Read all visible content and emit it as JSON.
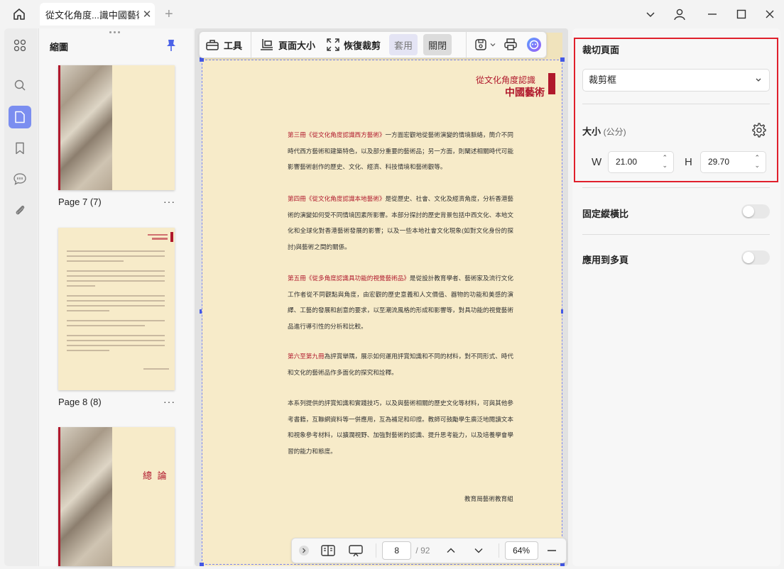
{
  "tab": {
    "title": "從文化角度...識中國藝術",
    "close": "✕"
  },
  "thumbnails": {
    "title": "縮圖",
    "pages": [
      {
        "label": "Page 7 (7)",
        "more": "···"
      },
      {
        "label": "Page 8 (8)",
        "more": "···"
      },
      {
        "heading": "總 論"
      }
    ]
  },
  "toolbar": {
    "tools": "工具",
    "page_size": "頁面大小",
    "restore_crop": "恢復裁剪",
    "apply": "套用",
    "close": "關閉"
  },
  "page": {
    "header_small": "從文化角度認識",
    "header_big": "中國藝術",
    "paragraphs": [
      {
        "red": "第三冊《從文化角度認識西方藝術》",
        "text": "一方面宏觀地從藝術演變的情境脈絡，簡介不同時代西方藝術和建築特色，以及部分重要的藝術品；另一方面，則闡述相關時代可能影響藝術創作的歷史、文化、經濟、科技情境和藝術觀等。"
      },
      {
        "red": "第四冊《從文化角度認識本地藝術》",
        "text": "是從歷史、社會、文化及經濟角度，分析香港藝術的演變如何受不同情境因素所影響。本部分探討的歷史背景包括中西文化、本地文化和全球化對香港藝術發展的影響；以及一些本地社會文化現象(如對文化身份的探討)與藝術之間的關係。"
      },
      {
        "red": "第五冊《從多角度認識具功能的視覺藝術品》",
        "text": "是從設計教育學者、藝術家及流行文化工作者從不同觀點與角度，由宏觀的歷史意義和人文價值、器物的功能和美感的演繹、工藝的發展和創意的要求，以至潮流風格的形成和影響等，對具功能的視覺藝術品進行導引性的分析和比較。"
      },
      {
        "red": "第六至第九冊",
        "text": "為評賞舉隅，展示如何運用評賞知識和不同的材料，對不同形式、時代和文化的藝術品作多面化的探究和詮釋。"
      },
      {
        "red": "",
        "text": "本系列提供的評賞知識和實踐技巧，以及與藝術相關的歷史文化等材料，可與其他參考書籍，互聯網資料等一併應用，互為補足和印證。教師可鼓勵學生廣泛地閱讀文本和視象參考材料，以擴濶視野、加強對藝術的認識、提升思考能力，以及培養學會學習的能力和態度。"
      }
    ],
    "signoff": "教育局藝術教育組"
  },
  "bottombar": {
    "current_page": "8",
    "total": "/ 92",
    "zoom": "64%"
  },
  "rightpanel": {
    "crop_title": "裁切頁面",
    "crop_mode": "裁剪框",
    "size_label": "大小",
    "size_unit": "(公分)",
    "w_label": "W",
    "w_value": "21.00",
    "h_label": "H",
    "h_value": "29.70",
    "lock_ratio": "固定縱橫比",
    "apply_multi": "應用到多頁"
  },
  "colors": {
    "accent": "#7b8ef0",
    "highlight": "#e0202c",
    "brand_red": "#b0182c",
    "paper": "#f7ebc9"
  }
}
